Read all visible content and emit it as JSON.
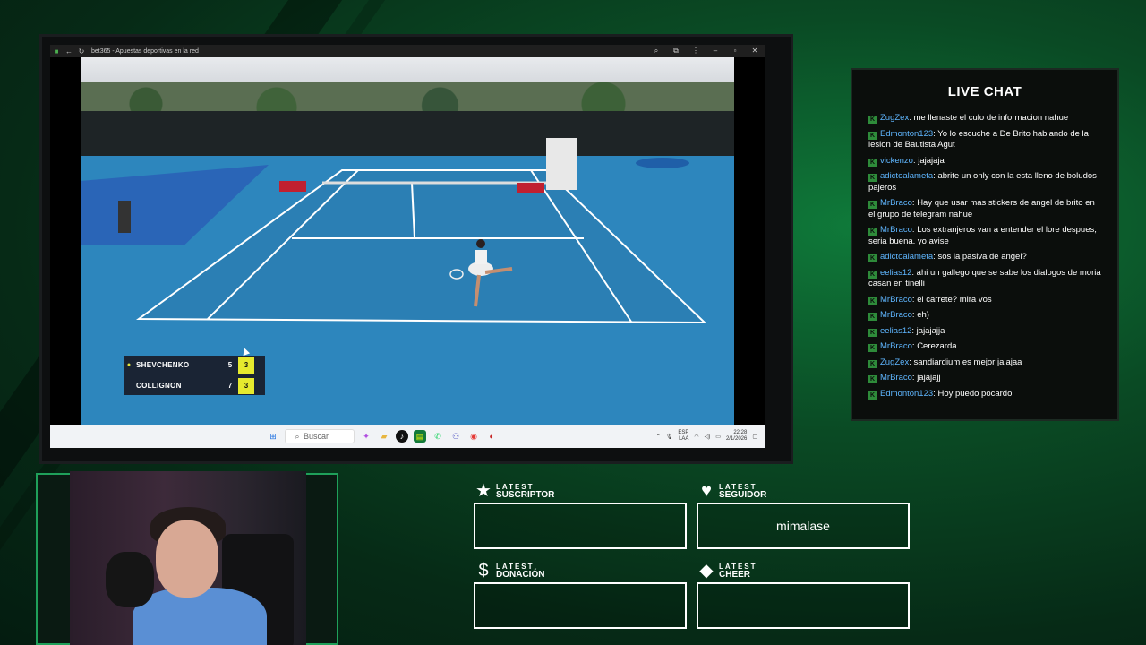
{
  "browser": {
    "tab_title": "bet365 - Apuestas deportivas en la red",
    "icons": [
      "back-icon",
      "reload-icon",
      "zoom-icon",
      "extensions-icon",
      "menu-icon"
    ],
    "window_controls": [
      "minimize-icon",
      "restore-icon",
      "close-icon"
    ]
  },
  "scoreboard": {
    "players": [
      {
        "name": "SHEVCHENKO",
        "sets": "5",
        "games": "3",
        "serving": true
      },
      {
        "name": "COLLIGNON",
        "sets": "7",
        "games": "3",
        "serving": false
      }
    ]
  },
  "taskbar": {
    "search_placeholder": "Buscar",
    "tray": {
      "lang_top": "ESP",
      "lang_bottom": "LAA",
      "time": "22:28",
      "date": "2/1/2026"
    }
  },
  "chat": {
    "title": "LIVE CHAT",
    "messages": [
      {
        "user": "ZugZex",
        "text": "me llenaste el culo de informacion nahue"
      },
      {
        "user": "Edmonton123",
        "text": "Yo lo escuche a De Brito hablando de la lesion de Bautista Agut"
      },
      {
        "user": "vickenzo",
        "text": "jajajaja"
      },
      {
        "user": "adictoalameta",
        "text": "abrite un only con la esta lleno de boludos pajeros"
      },
      {
        "user": "MrBraco",
        "text": "Hay que usar mas stickers de angel de brito en el grupo de telegram nahue"
      },
      {
        "user": "MrBraco",
        "text": "Los extranjeros van a entender el lore despues, seria buena. yo avise"
      },
      {
        "user": "adictoalameta",
        "text": "sos la pasiva de angel?"
      },
      {
        "user": "eelias12",
        "text": "ahi un gallego que se sabe los dialogos de moria casan en tinelli"
      },
      {
        "user": "MrBraco",
        "text": "el carrete? mira vos"
      },
      {
        "user": "MrBraco",
        "text": "eh)"
      },
      {
        "user": "eelias12",
        "text": "jajajajja"
      },
      {
        "user": "MrBraco",
        "text": "Cerezarda"
      },
      {
        "user": "ZugZex",
        "text": "sandiardium es mejor jajajaa"
      },
      {
        "user": "MrBraco",
        "text": "jajajajj"
      },
      {
        "user": "Edmonton123",
        "text": "Hoy puedo pocardo"
      }
    ]
  },
  "alerts": {
    "subscriber": {
      "small": "LATEST",
      "big": "SUSCRIPTOR",
      "value": ""
    },
    "follower": {
      "small": "LATEST",
      "big": "SEGUIDOR",
      "value": "mimalase"
    },
    "donation": {
      "small": "LATEST",
      "big": "DONACIÓN",
      "value": ""
    },
    "cheer": {
      "small": "LATEST",
      "big": "CHEER",
      "value": ""
    }
  },
  "colors": {
    "accent": "#1fa05a",
    "score_highlight": "#e6ea2e",
    "chat_user": "#5fb6ff"
  }
}
